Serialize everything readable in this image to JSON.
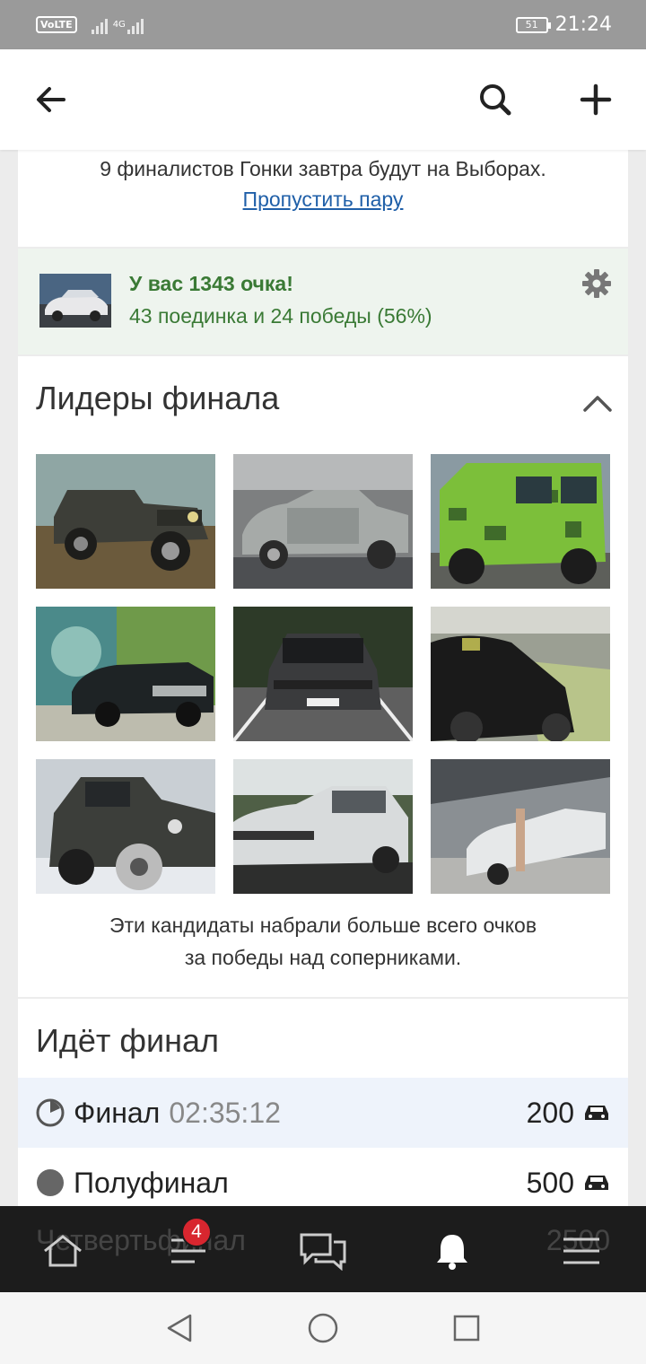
{
  "status_bar": {
    "volte": "VoLTE",
    "network": "4G",
    "battery": "51",
    "time": "21:24"
  },
  "app_bar": {
    "back_icon": "arrow-left-icon",
    "search_icon": "search-icon",
    "add_icon": "plus-icon"
  },
  "announcement": {
    "text": "9 финалистов Гонки завтра будут на Выборах.",
    "skip_link": "Пропустить пару"
  },
  "score": {
    "points": "У вас 1343 очка!",
    "stats": "43 поединка и 24 победы (56%)",
    "settings_icon": "gear-icon"
  },
  "leaders": {
    "title": "Лидеры финала",
    "collapse_icon": "chevron-up-icon",
    "photos": [
      {
        "name": "uaz-jeep"
      },
      {
        "name": "volga-garage"
      },
      {
        "name": "camo-van"
      },
      {
        "name": "volga-graffiti"
      },
      {
        "name": "bmw-front"
      },
      {
        "name": "black-hatchback"
      },
      {
        "name": "lada-niva"
      },
      {
        "name": "vw-passat"
      },
      {
        "name": "white-sedan-bridge"
      }
    ],
    "caption_line1": "Эти кандидаты набрали больше всего очков",
    "caption_line2": "за победы над соперниками."
  },
  "final": {
    "title": "Идёт финал",
    "rows": [
      {
        "label": "Финал",
        "timer": "02:35:12",
        "value": "200"
      },
      {
        "label": "Полуфинал",
        "value": "500"
      },
      {
        "label": "Четвертьфинал",
        "value": "2500"
      }
    ]
  },
  "bottom_nav": {
    "items": [
      "home-icon",
      "feed-icon",
      "messages-icon",
      "notifications-icon",
      "menu-icon"
    ],
    "feed_badge": "4"
  },
  "system_nav": {
    "items": [
      "back-triangle-icon",
      "home-circle-icon",
      "recents-square-icon"
    ]
  }
}
